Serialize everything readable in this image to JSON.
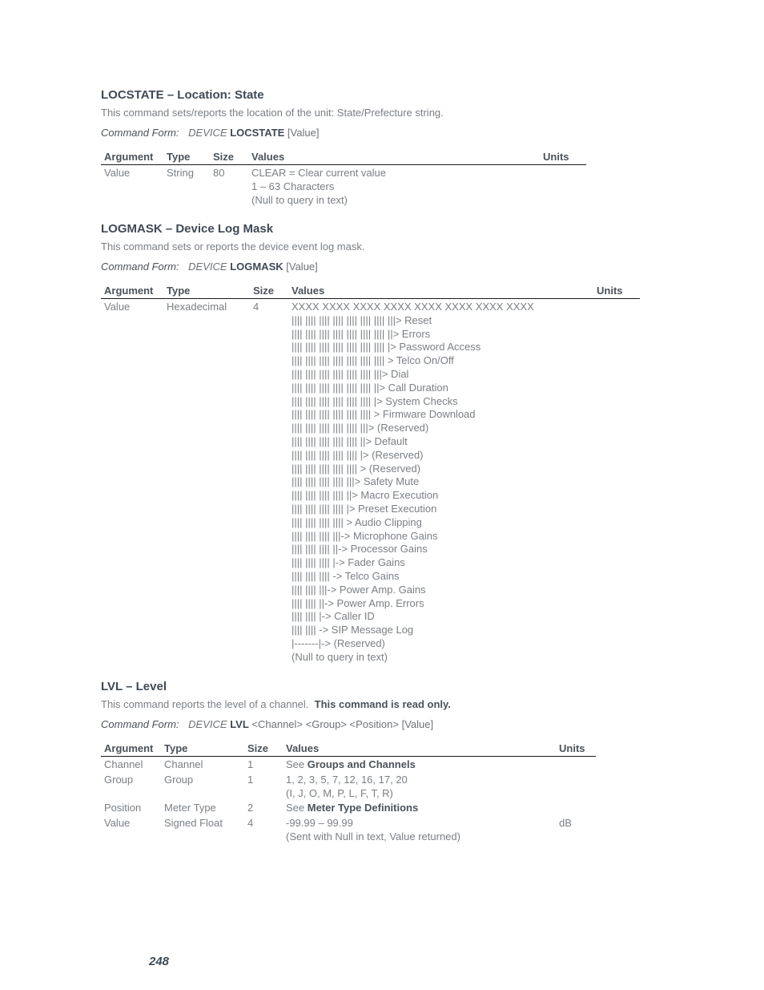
{
  "page_number": "248",
  "sections": [
    {
      "keyword": "LOCSTATE",
      "title_rest": " – Location: State",
      "description": "This command sets/reports the location of the unit: State/Prefecture string.",
      "command_form": {
        "label": "Command Form:",
        "device": "DEVICE",
        "keyword": "LOCSTATE",
        "args": " [Value]"
      },
      "table": {
        "headers": [
          "Argument",
          "Type",
          "Size",
          "Values",
          "Units"
        ],
        "rows": [
          {
            "argument": "Value",
            "type": "String",
            "size": "80",
            "values": [
              "CLEAR = Clear current value",
              "1 – 63 Characters",
              "(Null to query in text)"
            ],
            "units": ""
          }
        ]
      }
    },
    {
      "keyword": "LOGMASK",
      "title_rest": " – Device Log Mask",
      "description": "This command sets or reports the device event log mask.",
      "command_form": {
        "label": "Command Form:",
        "device": "DEVICE",
        "keyword": "LOGMASK",
        "args": " [Value]"
      },
      "table": {
        "headers": [
          "Argument",
          "Type",
          "Size",
          "Values",
          "Units"
        ],
        "rows": [
          {
            "argument": "Value",
            "type": "Hexadecimal",
            "size": "4",
            "values": [
              "XXXX XXXX XXXX XXXX XXXX XXXX XXXX XXXX",
              "|||| |||| |||| |||| |||| |||| |||| |||> Reset",
              "|||| |||| |||| |||| |||| |||| |||| ||> Errors",
              "|||| |||| |||| |||| |||| |||| |||| |> Password Access",
              "|||| |||| |||| |||| |||| |||| |||| > Telco On/Off",
              "|||| |||| |||| |||| |||| |||| |||> Dial",
              "|||| |||| |||| |||| |||| |||| ||> Call Duration",
              "|||| |||| |||| |||| |||| |||| |> System Checks",
              "|||| |||| |||| |||| |||| |||| > Firmware Download",
              "|||| |||| |||| |||| |||| |||> (Reserved)",
              "|||| |||| |||| |||| |||| ||> Default",
              "|||| |||| |||| |||| |||| |> (Reserved)",
              "|||| |||| |||| |||| |||| > (Reserved)",
              "|||| |||| |||| |||| |||> Safety Mute",
              "|||| |||| |||| |||| ||> Macro Execution",
              "|||| |||| |||| |||| |> Preset Execution",
              "|||| |||| |||| |||| > Audio Clipping",
              "|||| |||| |||| |||-> Microphone Gains",
              "|||| |||| |||| ||-> Processor Gains",
              "|||| |||| |||| |-> Fader Gains",
              "|||| |||| |||| -> Telco Gains",
              "|||| |||| |||-> Power Amp. Gains",
              "|||| |||| ||-> Power Amp. Errors",
              "|||| |||| |-> Caller ID",
              "|||| |||| -> SIP Message Log",
              "|-------|-> (Reserved)",
              "(Null to query in text)"
            ],
            "units": ""
          }
        ]
      }
    },
    {
      "keyword": "LVL",
      "title_rest": " – Level",
      "description": "This command reports the level of a channel.",
      "description_bold": "This command is read only.",
      "command_form": {
        "label": "Command Form:",
        "device": "DEVICE",
        "keyword": "LVL",
        "args": " <Channel> <Group> <Position> [Value]"
      },
      "table": {
        "headers": [
          "Argument",
          "Type",
          "Size",
          "Values",
          "Units"
        ],
        "rows": [
          {
            "argument": "Channel",
            "type": "Channel",
            "size": "1",
            "values_prefix": "See ",
            "values_bold": "Groups and Channels",
            "values": [],
            "units": ""
          },
          {
            "argument": "Group",
            "type": "Group",
            "size": "1",
            "values": [
              "1, 2, 3, 5, 7, 12, 16, 17, 20",
              "(I, J, O, M, P, L, F, T, R)"
            ],
            "units": ""
          },
          {
            "argument": "Position",
            "type": "Meter Type",
            "size": "2",
            "values_prefix": "See ",
            "values_bold": "Meter Type Definitions",
            "values": [],
            "units": ""
          },
          {
            "argument": "Value",
            "type": "Signed Float",
            "size": "4",
            "values": [
              "-99.99 – 99.99",
              "(Sent with Null in text, Value returned)"
            ],
            "units": "dB"
          }
        ]
      }
    }
  ]
}
